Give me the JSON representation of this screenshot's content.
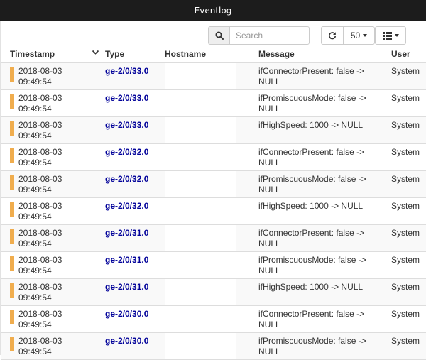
{
  "window": {
    "title": "Eventlog"
  },
  "toolbar": {
    "search_placeholder": "Search",
    "refresh_icon": "refresh-icon",
    "page_size": "50",
    "columns_icon": "list-icon"
  },
  "table": {
    "columns": {
      "timestamp": "Timestamp",
      "type": "Type",
      "hostname": "Hostname",
      "message": "Message",
      "user": "User"
    },
    "rows": [
      {
        "timestamp": "2018-08-03\n09:49:54",
        "type": "ge-2/0/33.0",
        "hostname": "",
        "message": "ifConnectorPresent: false -> NULL",
        "user": "System"
      },
      {
        "timestamp": "2018-08-03\n09:49:54",
        "type": "ge-2/0/33.0",
        "hostname": "",
        "message": "ifPromiscuousMode: false -> NULL",
        "user": "System"
      },
      {
        "timestamp": "2018-08-03\n09:49:54",
        "type": "ge-2/0/33.0",
        "hostname": "",
        "message": "ifHighSpeed: 1000 -> NULL",
        "user": "System"
      },
      {
        "timestamp": "2018-08-03\n09:49:54",
        "type": "ge-2/0/32.0",
        "hostname": "",
        "message": "ifConnectorPresent: false -> NULL",
        "user": "System"
      },
      {
        "timestamp": "2018-08-03\n09:49:54",
        "type": "ge-2/0/32.0",
        "hostname": "",
        "message": "ifPromiscuousMode: false -> NULL",
        "user": "System"
      },
      {
        "timestamp": "2018-08-03\n09:49:54",
        "type": "ge-2/0/32.0",
        "hostname": "",
        "message": "ifHighSpeed: 1000 -> NULL",
        "user": "System"
      },
      {
        "timestamp": "2018-08-03\n09:49:54",
        "type": "ge-2/0/31.0",
        "hostname": "",
        "message": "ifConnectorPresent: false -> NULL",
        "user": "System"
      },
      {
        "timestamp": "2018-08-03\n09:49:54",
        "type": "ge-2/0/31.0",
        "hostname": "",
        "message": "ifPromiscuousMode: false -> NULL",
        "user": "System"
      },
      {
        "timestamp": "2018-08-03\n09:49:54",
        "type": "ge-2/0/31.0",
        "hostname": "",
        "message": "ifHighSpeed: 1000 -> NULL",
        "user": "System"
      },
      {
        "timestamp": "2018-08-03\n09:49:54",
        "type": "ge-2/0/30.0",
        "hostname": "",
        "message": "ifConnectorPresent: false -> NULL",
        "user": "System"
      },
      {
        "timestamp": "2018-08-03\n09:49:54",
        "type": "ge-2/0/30.0",
        "hostname": "",
        "message": "ifPromiscuousMode: false -> NULL",
        "user": "System"
      }
    ]
  },
  "colors": {
    "severity_bar": "#f0ad4e",
    "type_link": "#000099",
    "titlebar": "#1c1c1c"
  }
}
